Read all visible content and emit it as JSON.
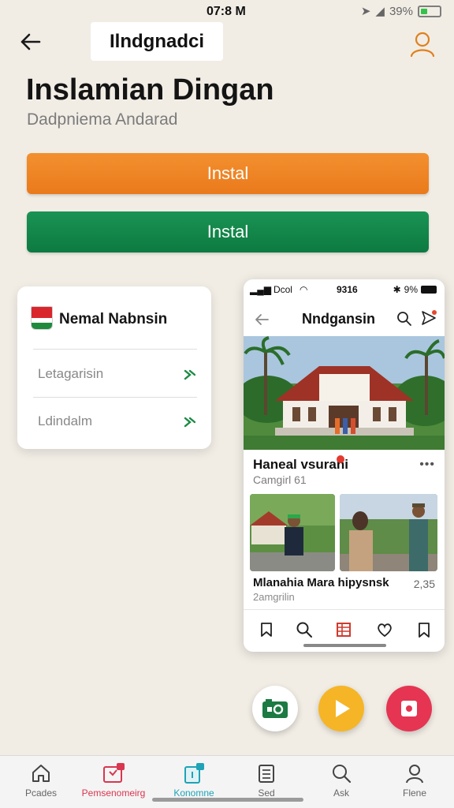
{
  "status_bar": {
    "time": "07:8 M",
    "battery_percent": "39%"
  },
  "header": {
    "title": "Ilndgnadci",
    "back_icon": "arrow-left-icon",
    "profile_icon": "user-icon"
  },
  "main": {
    "headline": "Inslamian Dingan",
    "subheadline": "Dadpniema Andarad",
    "buttons": [
      {
        "label": "Instal",
        "color": "#ee8425"
      },
      {
        "label": "Instal",
        "color": "#138747"
      }
    ]
  },
  "region_card": {
    "title": "Nemal Nabnsin",
    "items": [
      {
        "label": "Letagarisin"
      },
      {
        "label": "Ldindalm"
      }
    ]
  },
  "phone_preview": {
    "status": {
      "carrier": "Dcol",
      "time": "9316",
      "battery": "9%"
    },
    "title": "Nndgansin",
    "post": {
      "title": "Haneal vsurani",
      "subtitle": "Camgirl 61"
    },
    "gallery_caption": {
      "title": "Mlanahia Mara hipysnsk",
      "subtitle": "2amgrilin",
      "count": "2,35"
    }
  },
  "bottom_nav": {
    "items": [
      {
        "label": "Pcades",
        "color": "#666666"
      },
      {
        "label": "Pemsenomeirg",
        "color": "#d9364f"
      },
      {
        "label": "Konomne",
        "color": "#1fa3b7"
      },
      {
        "label": "Sed",
        "color": "#666666"
      },
      {
        "label": "Ask",
        "color": "#666666"
      },
      {
        "label": "Flene",
        "color": "#666666"
      }
    ]
  },
  "colors": {
    "accent_orange": "#ee8425",
    "accent_green": "#138747",
    "background": "#f1ede5"
  }
}
